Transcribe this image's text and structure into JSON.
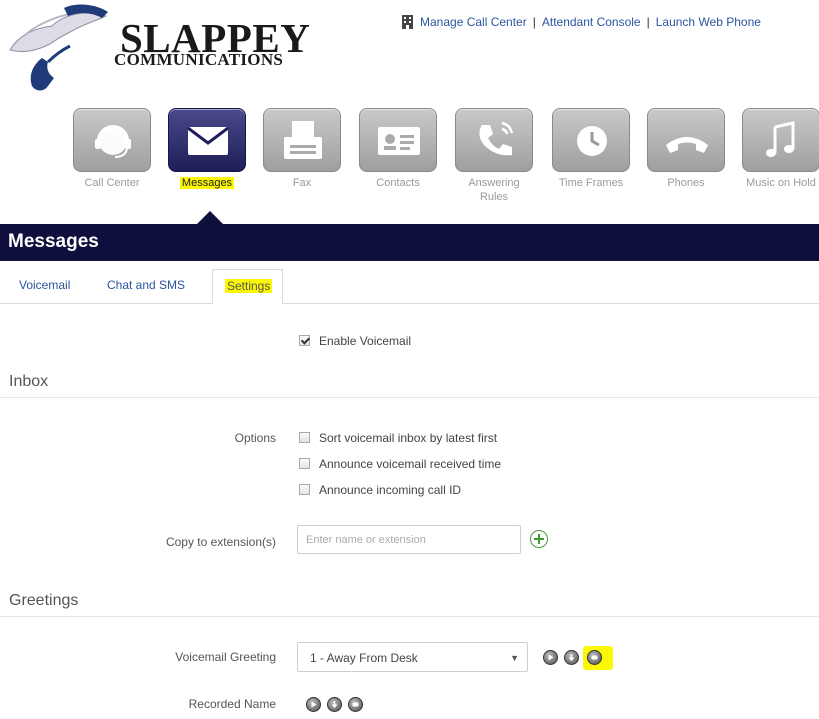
{
  "brand": {
    "name": "SLAPPEY",
    "sub": "COMMUNICATIONS"
  },
  "top_links": [
    "Manage Call Center",
    "Attendant Console",
    "Launch Web Phone"
  ],
  "apps": [
    {
      "label": "Call Center",
      "icon": "headset-icon"
    },
    {
      "label": "Messages",
      "icon": "envelope-icon",
      "active": true
    },
    {
      "label": "Fax",
      "icon": "fax-icon"
    },
    {
      "label": "Contacts",
      "icon": "contact-card-icon"
    },
    {
      "label": "Answering Rules",
      "icon": "phone-rules-icon"
    },
    {
      "label": "Time Frames",
      "icon": "clock-icon"
    },
    {
      "label": "Phones",
      "icon": "phone-handset-icon"
    },
    {
      "label": "Music on Hold",
      "icon": "music-note-icon"
    }
  ],
  "section": {
    "title": "Messages"
  },
  "tabs": [
    "Voicemail",
    "Chat and SMS",
    "Settings"
  ],
  "active_tab": "Settings",
  "enable_voicemail": {
    "label": "Enable Voicemail",
    "checked": true
  },
  "inbox": {
    "heading": "Inbox",
    "options_label": "Options",
    "options": [
      {
        "label": "Sort voicemail inbox by latest first",
        "checked": false
      },
      {
        "label": "Announce voicemail received time",
        "checked": false
      },
      {
        "label": "Announce incoming call ID",
        "checked": false
      }
    ],
    "copy_label": "Copy to extension(s)",
    "copy_placeholder": "Enter name or extension"
  },
  "greetings": {
    "heading": "Greetings",
    "voicemail_greeting_label": "Voicemail Greeting",
    "voicemail_greeting_value": "1 - Away From Desk",
    "recorded_name_label": "Recorded Name"
  },
  "colors": {
    "nav_dark": "#0f0f3e",
    "link": "#2b55a3",
    "highlight": "#fbf705"
  }
}
